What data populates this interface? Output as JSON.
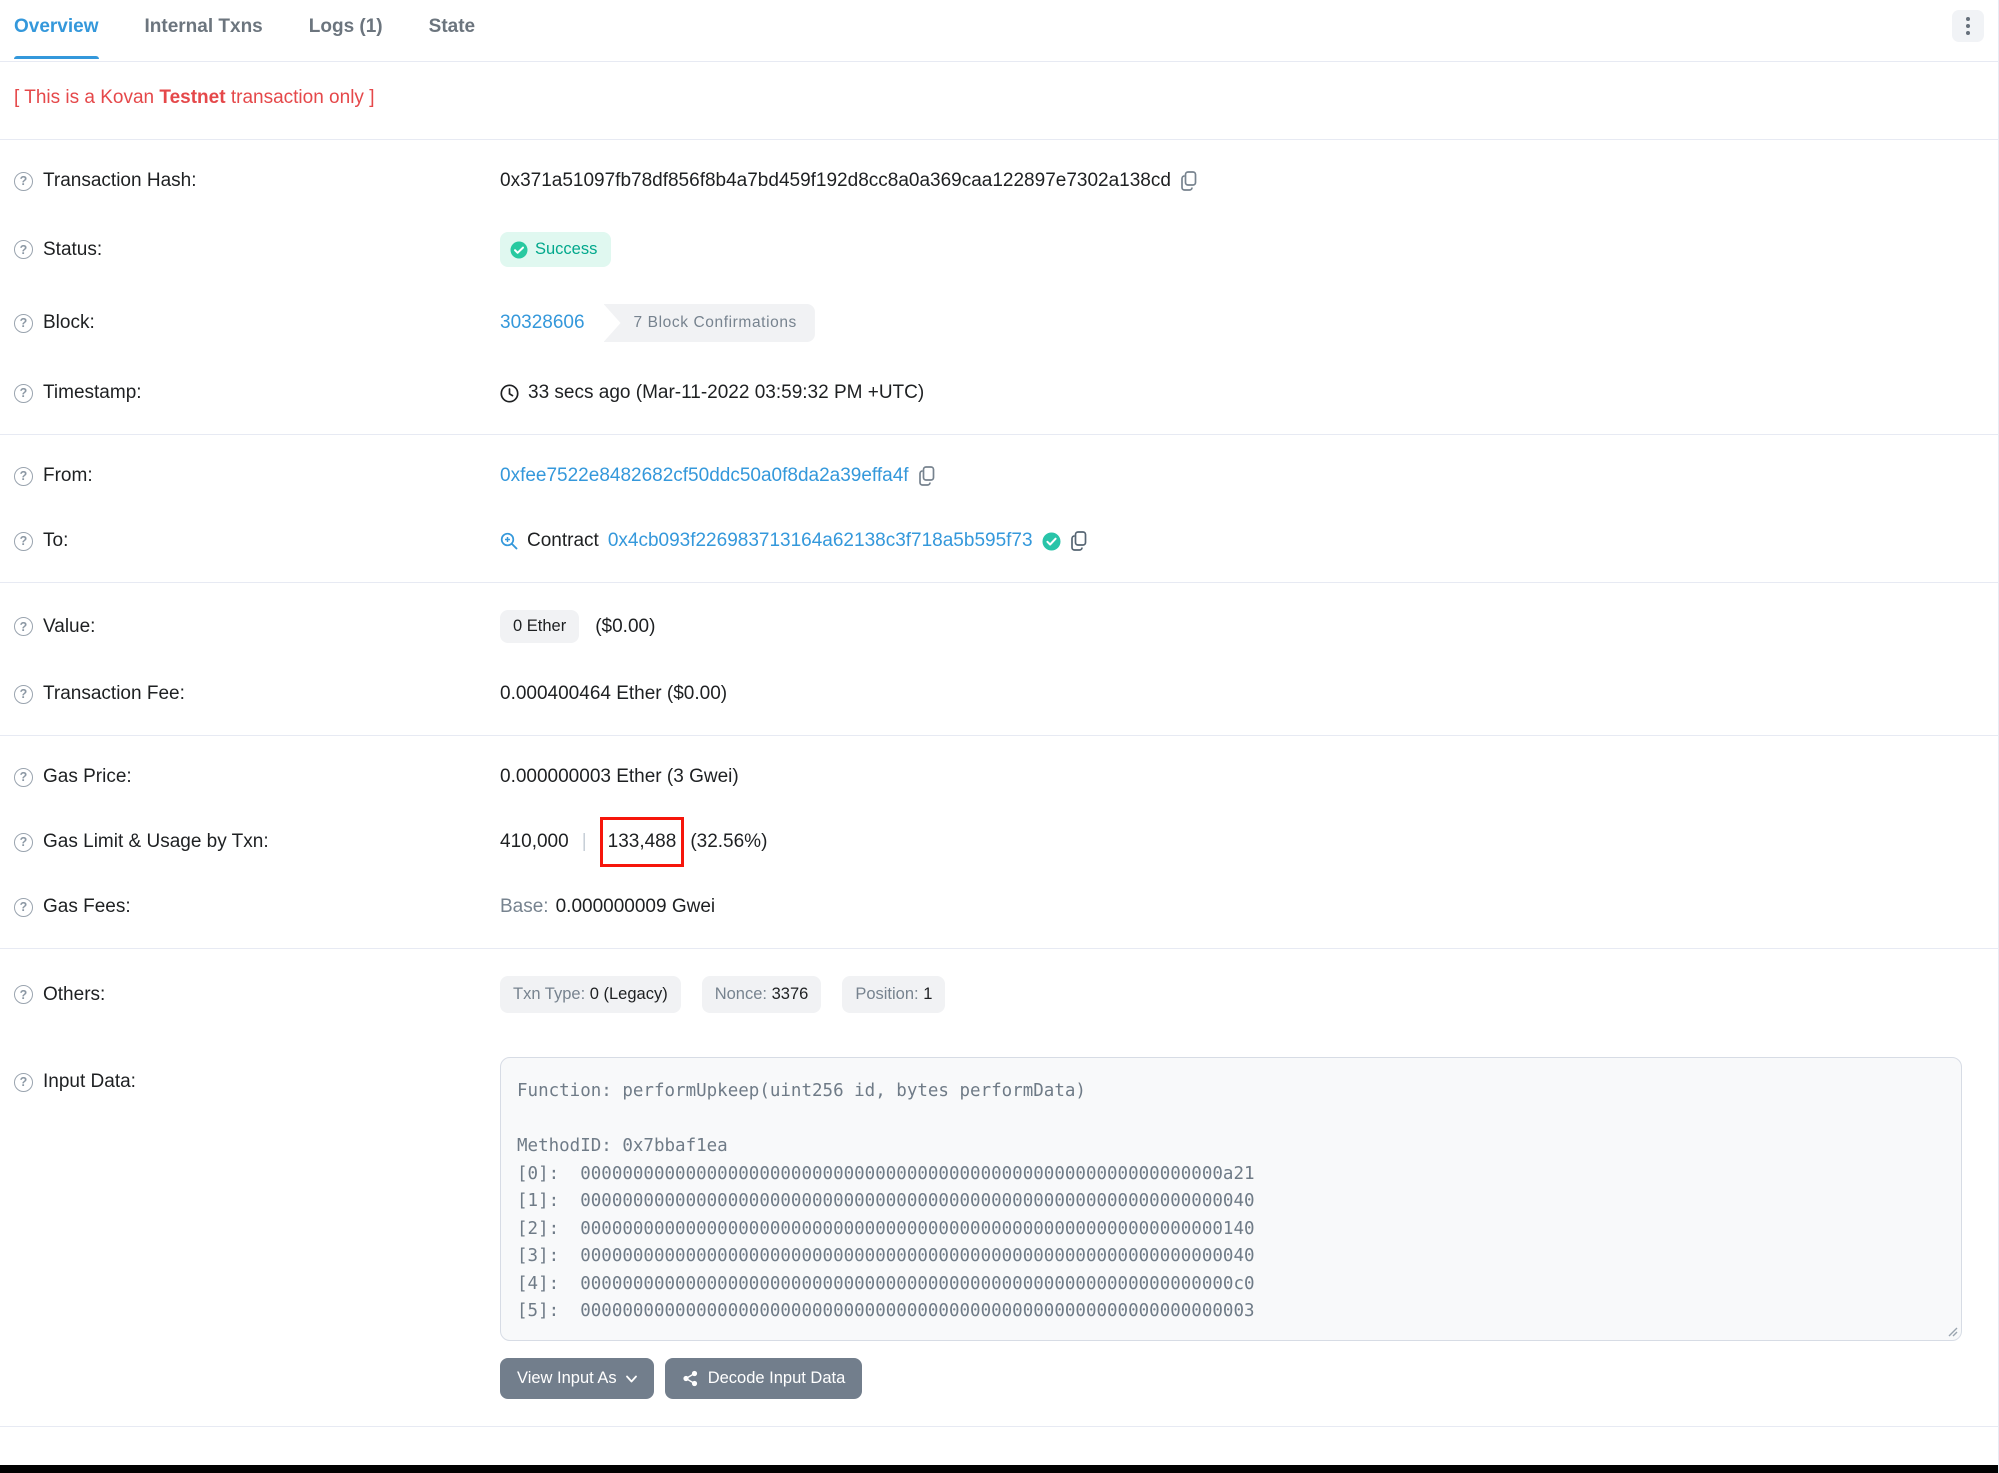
{
  "tabs": [
    {
      "label": "Overview",
      "active": true
    },
    {
      "label": "Internal Txns",
      "active": false
    },
    {
      "label": "Logs (1)",
      "active": false
    },
    {
      "label": "State",
      "active": false
    }
  ],
  "notice": {
    "prefix": "[ This is a Kovan ",
    "bold": "Testnet",
    "suffix": " transaction only ]"
  },
  "rows": {
    "transaction_hash": {
      "label": "Transaction Hash:",
      "value": "0x371a51097fb78df856f8b4a7bd459f192d8cc8a0a369caa122897e7302a138cd"
    },
    "status": {
      "label": "Status:",
      "value": "Success"
    },
    "block": {
      "label": "Block:",
      "value": "30328606",
      "confirmations": "7 Block Confirmations"
    },
    "timestamp": {
      "label": "Timestamp:",
      "value": "33 secs ago (Mar-11-2022 03:59:32 PM +UTC)"
    },
    "from": {
      "label": "From:",
      "value": "0xfee7522e8482682cf50ddc50a0f8da2a39effa4f"
    },
    "to": {
      "label": "To:",
      "contract_word": "Contract",
      "value": "0x4cb093f226983713164a62138c3f718a5b595f73"
    },
    "value": {
      "label": "Value:",
      "badge": "0 Ether",
      "usd": "($0.00)"
    },
    "transaction_fee": {
      "label": "Transaction Fee:",
      "value": "0.000400464 Ether ($0.00)"
    },
    "gas_price": {
      "label": "Gas Price:",
      "value": "0.000000003 Ether (3 Gwei)"
    },
    "gas_limit": {
      "label": "Gas Limit & Usage by Txn:",
      "limit": "410,000",
      "separator": "|",
      "used": "133,488",
      "percent": "(32.56%)"
    },
    "gas_fees": {
      "label": "Gas Fees:",
      "base_label": "Base:",
      "base_value": "0.000000009 Gwei"
    },
    "others": {
      "label": "Others:",
      "badges": [
        {
          "label": "Txn Type:",
          "value": "0 (Legacy)"
        },
        {
          "label": "Nonce:",
          "value": "3376"
        },
        {
          "label": "Position:",
          "value": "1"
        }
      ]
    },
    "input_data": {
      "label": "Input Data:",
      "code": "Function: performUpkeep(uint256 id, bytes performData)\n\nMethodID: 0x7bbaf1ea\n[0]:  0000000000000000000000000000000000000000000000000000000000000a21\n[1]:  0000000000000000000000000000000000000000000000000000000000000040\n[2]:  0000000000000000000000000000000000000000000000000000000000000140\n[3]:  0000000000000000000000000000000000000000000000000000000000000040\n[4]:  00000000000000000000000000000000000000000000000000000000000000c0\n[5]:  0000000000000000000000000000000000000000000000000000000000000003"
    }
  },
  "buttons": {
    "view_input_as": "View Input As",
    "decode_input_data": "Decode Input Data"
  },
  "icons": {
    "question": "?"
  },
  "colors": {
    "accent_blue": "#3498db",
    "success_teal": "#00c9a7",
    "notice_red": "#e5484a",
    "annotation_red": "#f6150b",
    "muted_gray": "#77838f"
  }
}
